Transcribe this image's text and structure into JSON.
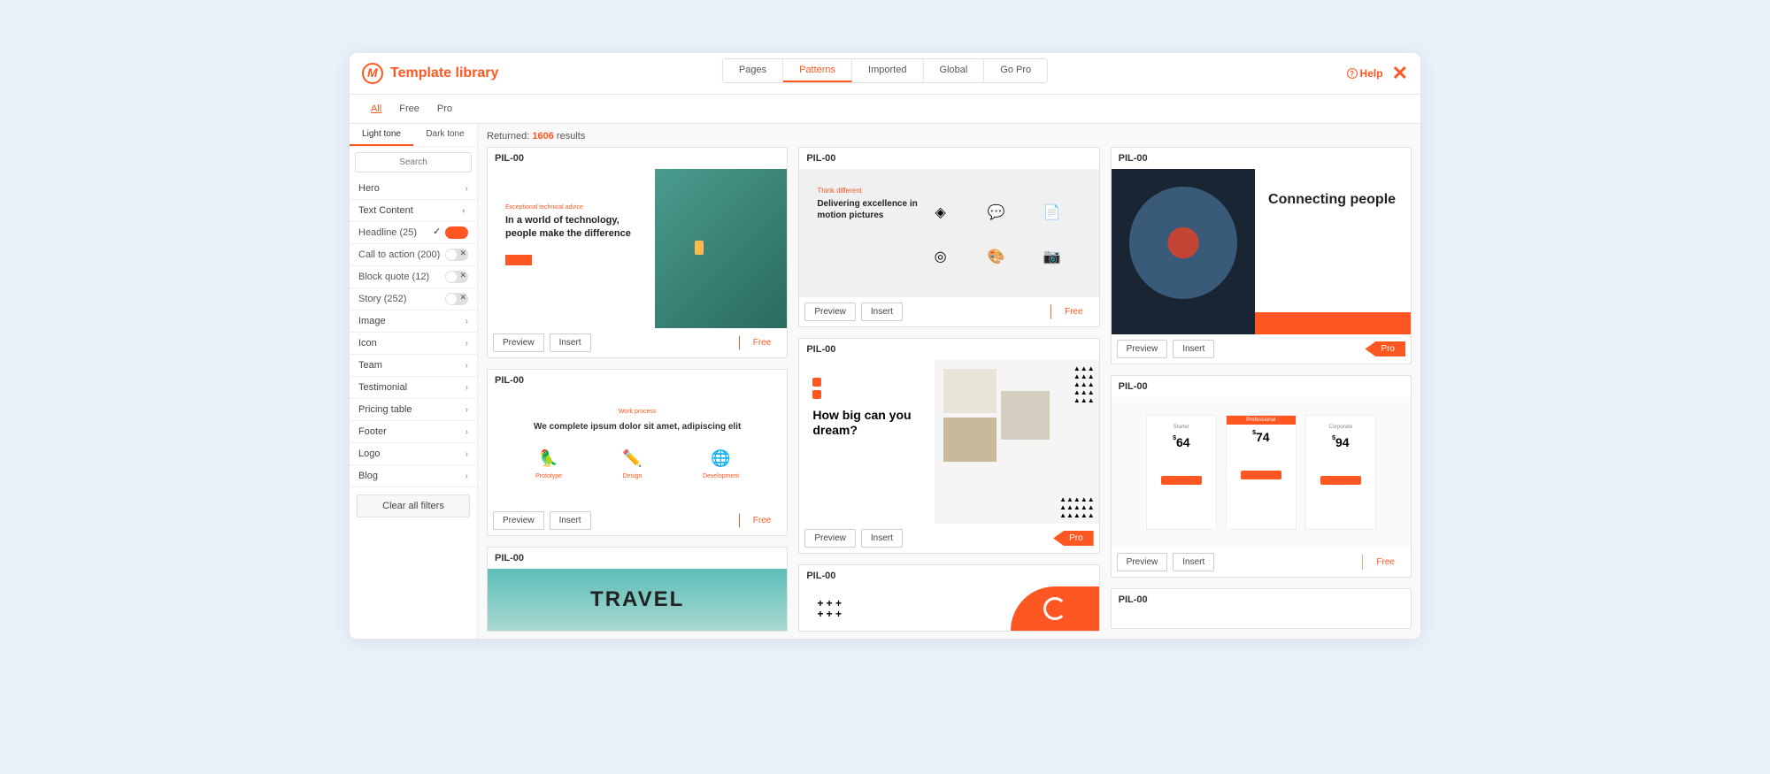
{
  "header": {
    "title": "Template library",
    "help": "Help"
  },
  "priceFilter": {
    "all": "All",
    "free": "Free",
    "pro": "Pro"
  },
  "mainTabs": {
    "pages": "Pages",
    "patterns": "Patterns",
    "imported": "Imported",
    "global": "Global",
    "gopro": "Go Pro"
  },
  "sidebar": {
    "toneLight": "Light tone",
    "toneDark": "Dark tone",
    "searchPlaceholder": "Search",
    "categories": {
      "hero": "Hero",
      "textContent": "Text Content",
      "image": "Image",
      "icon": "Icon",
      "team": "Team",
      "testimonial": "Testimonial",
      "pricingTable": "Pricing table",
      "footer": "Footer",
      "logo": "Logo",
      "blog": "Blog"
    },
    "textContentSub": {
      "headline": "Headline (25)",
      "cta": "Call to action (200)",
      "blockquote": "Block quote (12)",
      "story": "Story (252)"
    },
    "clearFilters": "Clear all filters"
  },
  "results": {
    "returnedPrefix": "Returned:",
    "count": "1606",
    "returnedSuffix": "results"
  },
  "card": {
    "title": "PIL-00",
    "preview": "Preview",
    "insert": "Insert",
    "free": "Free",
    "pro": "Pro"
  },
  "thumbs": {
    "t1_sub": "Exceptional technical advice",
    "t1_h": "In a world of technology, people make the difference",
    "t2_sub": "Think different",
    "t2_h": "Delivering excellence in motion pictures",
    "t3_h": "Connecting people",
    "t4_sub": "Work process",
    "t4_h": "We complete ipsum dolor sit amet, adipiscing elit",
    "t4_a": "Prototype",
    "t4_b": "Design",
    "t4_c": "Development",
    "t5_h": "How big can you dream?",
    "t6_a_t": "Starter",
    "t6_a_p": "64",
    "t6_b_t": "Professional",
    "t6_b_p": "74",
    "t6_c_t": "Corporate",
    "t6_c_p": "94",
    "t7_h": "TRAVEL"
  }
}
